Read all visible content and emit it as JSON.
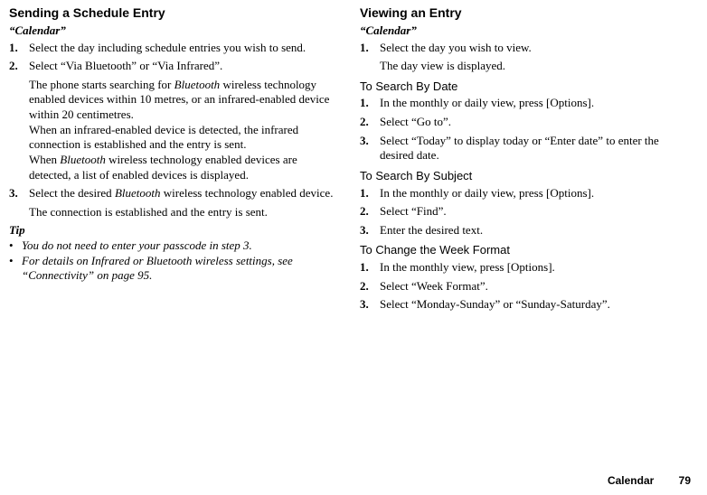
{
  "left": {
    "title": "Sending a Schedule Entry",
    "context": "“Calendar”",
    "steps": [
      {
        "n": "1.",
        "text": "Select the day including schedule entries you wish to send."
      },
      {
        "n": "2.",
        "text": "Select “Via Bluetooth” or “Via Infrared”.",
        "sub_html": "The phone starts searching for <span class=\"it\">Bluetooth</span> wireless technology enabled devices within 10 metres, or an infrared-enabled device within 20 centimetres.<br>When an infrared-enabled device is detected, the infrared connection is established and the entry is sent.<br>When <span class=\"it\">Bluetooth</span> wireless technology enabled devices are detected, a list of enabled devices is displayed."
      },
      {
        "n": "3.",
        "text_html": "Select the desired <span class=\"it\">Bluetooth</span> wireless technology enabled device.",
        "sub": "The connection is established and the entry is sent."
      }
    ],
    "tip_label": "Tip",
    "tips": [
      "You do not need to enter your passcode in step 3.",
      "For details on Infrared or Bluetooth wireless settings, see “Connectivity” on page 95."
    ]
  },
  "right": {
    "title": "Viewing an Entry",
    "context": "“Calendar”",
    "main_steps": [
      {
        "n": "1.",
        "text": "Select the day you wish to view.",
        "sub": "The day view is displayed."
      }
    ],
    "sections": [
      {
        "heading": "To Search By Date",
        "steps": [
          {
            "n": "1.",
            "text": "In the monthly or daily view, press [Options]."
          },
          {
            "n": "2.",
            "text": "Select “Go to”."
          },
          {
            "n": "3.",
            "text": "Select “Today” to display today or “Enter date” to enter the desired date."
          }
        ]
      },
      {
        "heading": "To Search By Subject",
        "steps": [
          {
            "n": "1.",
            "text": "In the monthly or daily view, press [Options]."
          },
          {
            "n": "2.",
            "text": "Select “Find”."
          },
          {
            "n": "3.",
            "text": "Enter the desired text."
          }
        ]
      },
      {
        "heading": "To Change the Week Format",
        "steps": [
          {
            "n": "1.",
            "text": "In the monthly view, press [Options]."
          },
          {
            "n": "2.",
            "text": "Select “Week Format”."
          },
          {
            "n": "3.",
            "text": "Select “Monday-Sunday” or “Sunday-Saturday”."
          }
        ]
      }
    ]
  },
  "footer": {
    "section": "Calendar",
    "page": "79"
  }
}
